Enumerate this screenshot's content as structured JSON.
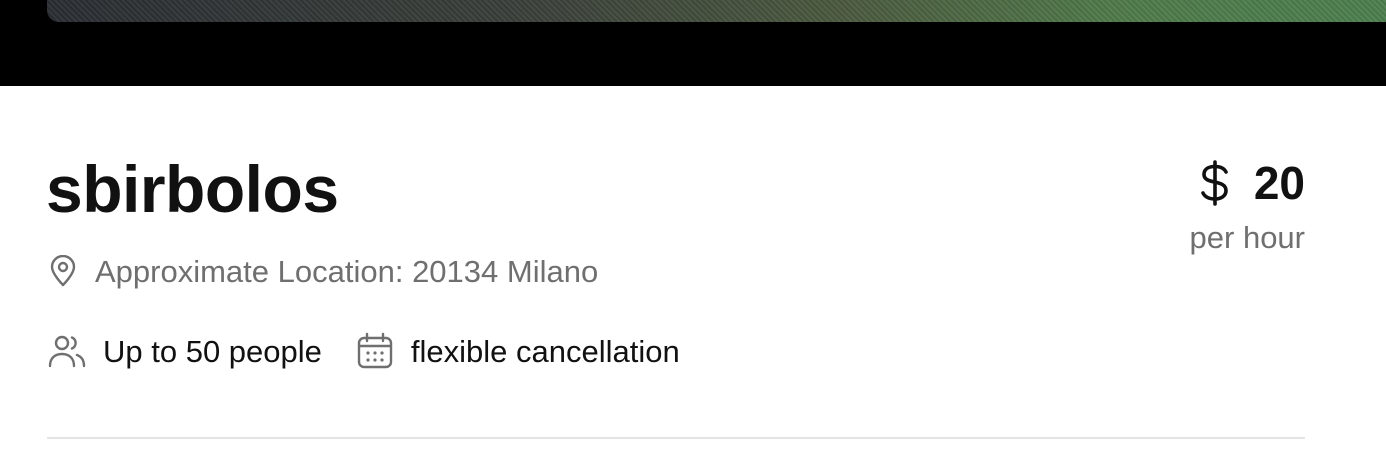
{
  "listing": {
    "title": "sbirbolos",
    "location_label": "Approximate Location: 20134 Milano",
    "capacity": "Up to 50 people",
    "cancellation": "flexible cancellation",
    "price": {
      "currency_icon": "dollar-icon",
      "amount": "20",
      "unit": "per hour"
    }
  },
  "icons": {
    "location": "map-pin-icon",
    "capacity": "users-icon",
    "cancellation": "calendar-icon"
  },
  "colors": {
    "text_primary": "#111111",
    "text_secondary": "#6f6f6f",
    "divider": "#e3e3e3",
    "hero_band": "#000000"
  }
}
